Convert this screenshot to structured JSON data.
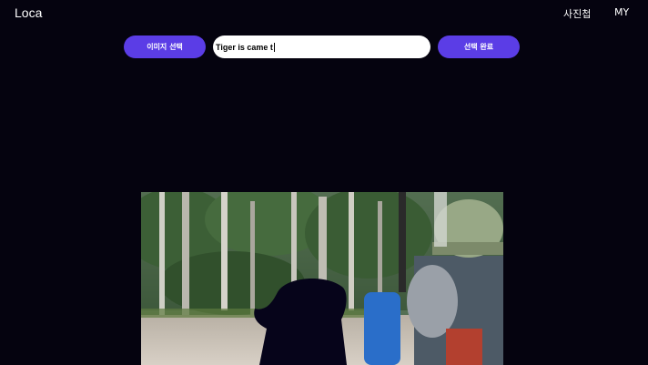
{
  "app": {
    "logo": "Loca"
  },
  "nav": {
    "album_label": "사진첩",
    "my_label": "MY"
  },
  "toolbar": {
    "select_image_label": "이미지 선택",
    "caption_value": "Tiger is came t",
    "complete_label": "선택 완료"
  },
  "colors": {
    "background": "#05030f",
    "accent": "#5b3de6"
  },
  "photo": {
    "description_icon": "forest-photo"
  }
}
